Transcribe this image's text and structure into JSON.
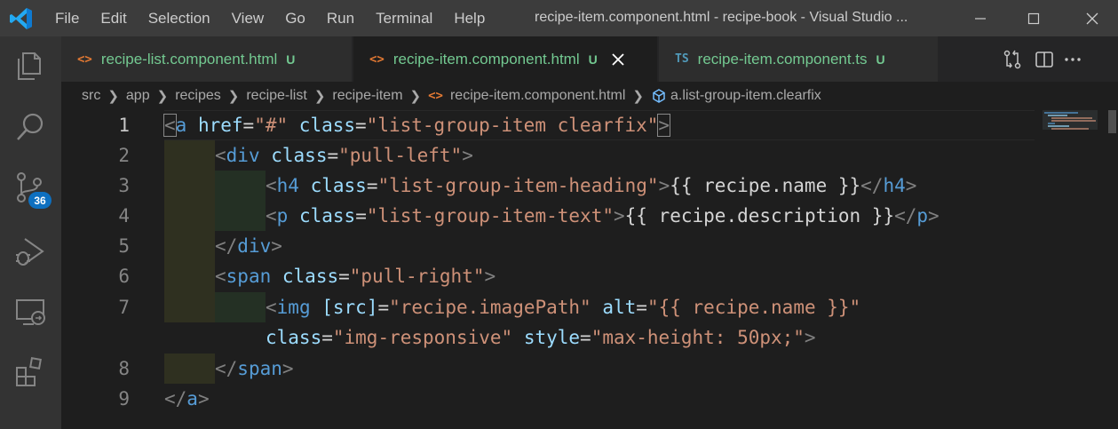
{
  "titlebar": {
    "menu": [
      "File",
      "Edit",
      "Selection",
      "View",
      "Go",
      "Run",
      "Terminal",
      "Help"
    ],
    "window_title": "recipe-item.component.html - recipe-book - Visual Studio ..."
  },
  "activitybar": {
    "source_control_badge": "36"
  },
  "tabs": [
    {
      "icon": "<>",
      "label": "recipe-list.component.html",
      "status": "U",
      "active": false
    },
    {
      "icon": "<>",
      "label": "recipe-item.component.html",
      "status": "U",
      "active": true
    },
    {
      "icon": "TS",
      "label": "recipe-item.component.ts",
      "status": "U",
      "active": false
    }
  ],
  "breadcrumb": {
    "segments": [
      "src",
      "app",
      "recipes",
      "recipe-list",
      "recipe-item"
    ],
    "file": "recipe-item.component.html",
    "symbol": "a.list-group-item.clearfix"
  },
  "editor": {
    "line_numbers": [
      "1",
      "2",
      "3",
      "4",
      "5",
      "6",
      "7",
      "8",
      "9"
    ],
    "lines": {
      "l1": {
        "t1": "<",
        "t2": "a",
        "a1": "href",
        "eq1": "=",
        "s1": "\"#\"",
        "a2": "class",
        "eq2": "=",
        "s2": "\"list-group-item clearfix\"",
        "t3": ">"
      },
      "l2": {
        "t1": "<",
        "t2": "div",
        "a1": "class",
        "eq1": "=",
        "s1": "\"pull-left\"",
        "t3": ">"
      },
      "l3": {
        "t1": "<",
        "t2": "h4",
        "a1": "class",
        "eq1": "=",
        "s1": "\"list-group-item-heading\"",
        "t3": ">",
        "x1": "{{ recipe.name }}",
        "t4": "</",
        "t5": "h4",
        "t6": ">"
      },
      "l4": {
        "t1": "<",
        "t2": "p",
        "a1": "class",
        "eq1": "=",
        "s1": "\"list-group-item-text\"",
        "t3": ">",
        "x1": "{{ recipe.description }}",
        "t4": "</",
        "t5": "p",
        "t6": ">"
      },
      "l5": {
        "t1": "</",
        "t2": "div",
        "t3": ">"
      },
      "l6": {
        "t1": "<",
        "t2": "span",
        "a1": "class",
        "eq1": "=",
        "s1": "\"pull-right\"",
        "t3": ">"
      },
      "l7": {
        "t1": "<",
        "t2": "img",
        "a1": "[src]",
        "eq1": "=",
        "s1": "\"recipe.imagePath\"",
        "a2": "alt",
        "eq2": "=",
        "s2": "\"{{ recipe.name }}\""
      },
      "l7b": {
        "a1": "class",
        "eq1": "=",
        "s1": "\"img-responsive\"",
        "a2": "style",
        "eq2": "=",
        "s2": "\"max-height: 50px;\"",
        "t3": ">"
      },
      "l8": {
        "t1": "</",
        "t2": "span",
        "t3": ">"
      },
      "l9": {
        "t1": "</",
        "t2": "a",
        "t3": ">"
      }
    }
  },
  "colors": {
    "tag": "#569cd6",
    "attribute": "#9cdcfe",
    "string": "#ce9178",
    "text": "#d4d4d4",
    "untracked": "#73c991",
    "html_icon": "#e37933",
    "ts_icon": "#519aba"
  }
}
